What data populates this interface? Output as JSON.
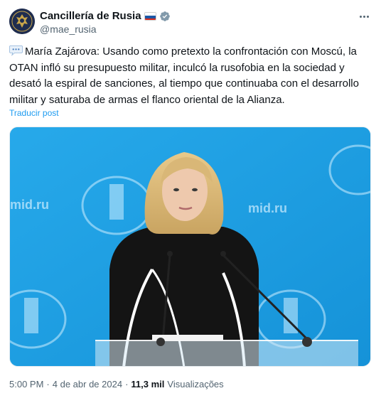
{
  "post": {
    "author": {
      "display_name": "Cancillería de Rusia",
      "handle": "@mae_rusia",
      "flag_icon": "russia-flag-icon",
      "verified_icon": "verified-badge-icon",
      "verified_color": "#829aab"
    },
    "more_icon": "more-options-icon",
    "text": "María Zajárova: Usando como pretexto la confrontación con Moscú, la OTAN infló su presupuesto militar, inculcó la rusofobia en la sociedad y desató la espiral de sanciones, al tiempo que continuaba con el desarrollo militar y saturaba de armas el flanco oriental de la Alianza.",
    "text_prefix_icon": "speech-balloon-icon",
    "translate_label": "Traducir post",
    "media": {
      "backdrop_label": "mid.ru"
    },
    "meta": {
      "time": "5:00 PM",
      "separator": "·",
      "date": "4 de abr de 2024",
      "separator2": "·",
      "views_count": "11,3 mil",
      "views_label": "Visualizações"
    }
  },
  "colors": {
    "link": "#1d9bf0",
    "secondary_text": "#536471",
    "primary_text": "#0f1419",
    "media_background": "#1aa1e4"
  }
}
